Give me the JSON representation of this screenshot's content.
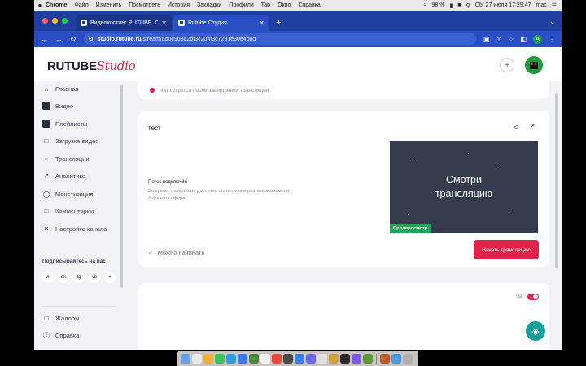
{
  "menubar": {
    "apple": "",
    "items": [
      "Chrome",
      "Файл",
      "Изменить",
      "Посмотреть",
      "История",
      "Закладки",
      "Профили",
      "Tab",
      "Окно",
      "Справка"
    ],
    "battery": "98 %",
    "datetime": "Сб, 27 июля  17:29:47",
    "user": "mac"
  },
  "browser": {
    "tabs": [
      {
        "title": "Видеохостинг RUTUBE. Смот",
        "active": false
      },
      {
        "title": "Rutube Студия",
        "active": true
      }
    ],
    "new_tab": "+",
    "url_host": "studio.rutube.ru",
    "url_path": "/stream/ab0c963a2bf3c204f3c7231e30e4bffd",
    "profile_initial": "A"
  },
  "logo": {
    "main": "RUTUBE",
    "accent": "Studio"
  },
  "sidebar": {
    "items": [
      {
        "label": "Главная",
        "icon": "home-icon"
      },
      {
        "label": "Видео",
        "icon": "video-icon"
      },
      {
        "label": "Плейлисты",
        "icon": "playlist-icon"
      },
      {
        "label": "Загрузка видео",
        "icon": "upload-icon"
      },
      {
        "label": "Трансляции",
        "icon": "broadcast-icon"
      },
      {
        "label": "Аналитика",
        "icon": "analytics-icon"
      },
      {
        "label": "Монетизация",
        "icon": "monetization-icon"
      },
      {
        "label": "Комментарии",
        "icon": "comments-icon"
      },
      {
        "label": "Настройка канала",
        "icon": "settings-icon"
      }
    ],
    "follow_label": "Подписывайтесь на нас",
    "social": [
      "vk",
      "ok",
      "tg",
      "vb",
      "+"
    ],
    "bottom_items": [
      {
        "label": "Жалобы",
        "icon": "complaints-icon"
      },
      {
        "label": "Справка",
        "icon": "help-icon"
      }
    ]
  },
  "notice": {
    "text": "Чат сотрется после завершения трансляции"
  },
  "stream": {
    "title": "тест",
    "status_heading": "Поток подключён",
    "status_text_1": "Во время трансляции доступна статистика в реальном времени.",
    "status_text_2": "Хорошего эфира!",
    "preview_line1": "Смотри",
    "preview_line2": "трансляцию",
    "preview_tag": "Предпросмотр",
    "ready_label": "Можно начинать",
    "start_button": "Начать трансляцию"
  },
  "chat": {
    "label": "Чат",
    "enabled": true
  },
  "colors": {
    "brand": "#e0234a",
    "browser_chrome": "#2a4fc4",
    "preview_bg": "#343b4a",
    "success": "#22a35a"
  },
  "dock": {
    "icon_colors": [
      "#6aa0e8",
      "#e8e8e8",
      "#f0b030",
      "#3bc45a",
      "#2ea0e0",
      "#3a7ae8",
      "#4a8a3a",
      "#f2f2f2",
      "#e84a3a",
      "#4a4a4a",
      "#3a80e0",
      "#6a6ae8",
      "#e0e0e0",
      "#d0a040",
      "#2a2a2a",
      "#7a5ae0",
      "#5a9a3a",
      "#c05a2a",
      "#4a9ae8",
      "#b0b0b0"
    ]
  }
}
